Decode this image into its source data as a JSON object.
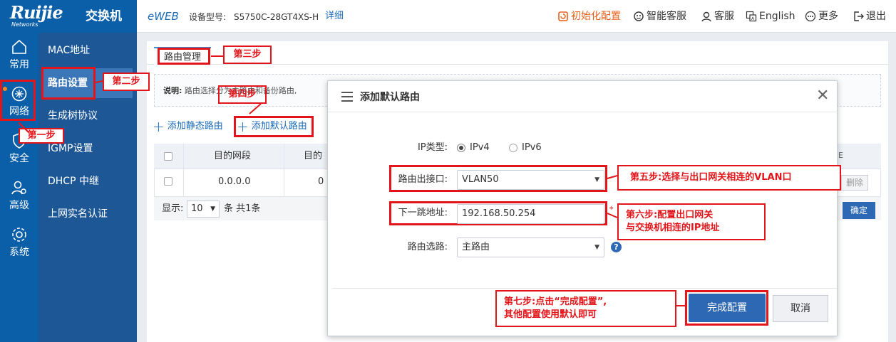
{
  "header": {
    "logo": "Ruijie",
    "logo_sub": "Networks",
    "product": "交换机",
    "eweb": "eWEB",
    "model_label": "设备型号:",
    "model_value": "S5750C-28GT4XS-H",
    "detail": "详细",
    "links": [
      {
        "label": "初始化配置",
        "icon": "reset-icon",
        "color": "#e8601c"
      },
      {
        "label": "智能客服",
        "icon": "smart-service-icon"
      },
      {
        "label": "客服",
        "icon": "user-service-icon"
      },
      {
        "label": "English",
        "icon": "language-icon"
      },
      {
        "label": "更多",
        "icon": "more-icon"
      },
      {
        "label": "退出",
        "icon": "logout-icon"
      }
    ]
  },
  "sidenav": [
    {
      "label": "常用",
      "icon": "home-icon"
    },
    {
      "label": "网络",
      "icon": "network-icon"
    },
    {
      "label": "安全",
      "icon": "shield-icon"
    },
    {
      "label": "高级",
      "icon": "advanced-user-icon"
    },
    {
      "label": "系统",
      "icon": "gear-icon"
    }
  ],
  "subnav": [
    "MAC地址",
    "路由设置",
    "生成树协议",
    "IGMP设置",
    "DHCP 中继",
    "上网实名认证"
  ],
  "tab": "路由管理",
  "description": {
    "label": "说明:",
    "text": "路由选择分为主路由和备份路由,"
  },
  "actions": [
    "添加静态路由",
    "添加默认路由"
  ],
  "table": {
    "headers": [
      "目的网段",
      "目的"
    ],
    "rows": [
      [
        "0.0.0.0",
        "0"
      ]
    ],
    "delete": "删除",
    "footer": {
      "show": "显示:",
      "page_size": "10",
      "total": "条 共1条"
    },
    "confirm": "确定"
  },
  "modal": {
    "title": "添加默认路由",
    "ip_type_label": "IP类型:",
    "ip_types": [
      "IPv4",
      "IPv6"
    ],
    "ip_type_selected": "IPv4",
    "interface_label": "路由出接口:",
    "interface_value": "VLAN50",
    "nexthop_label": "下一跳地址:",
    "nexthop_value": "192.168.50.254",
    "required_mark": "*",
    "route_label": "路由选路:",
    "route_value": "主路由",
    "help": "?",
    "ok": "完成配置",
    "cancel": "取消"
  },
  "annotations": {
    "step1": "第一步",
    "step2": "第二步",
    "step3": "第三步",
    "step4": "第四步",
    "step5": "第五步:选择与出口网关相连的VLAN口",
    "step6_line1": "第六步:配置出口网关",
    "step6_line2": "与交换机相连的IP地址",
    "step7_line1": "第七步:点击“完成配置”,",
    "step7_line2": "其他配置使用默认即可"
  },
  "colors": {
    "brand": "#0b5ea8",
    "subnav": "#1e5795",
    "accent": "#2d68b5",
    "annotation": "#e2161a"
  }
}
